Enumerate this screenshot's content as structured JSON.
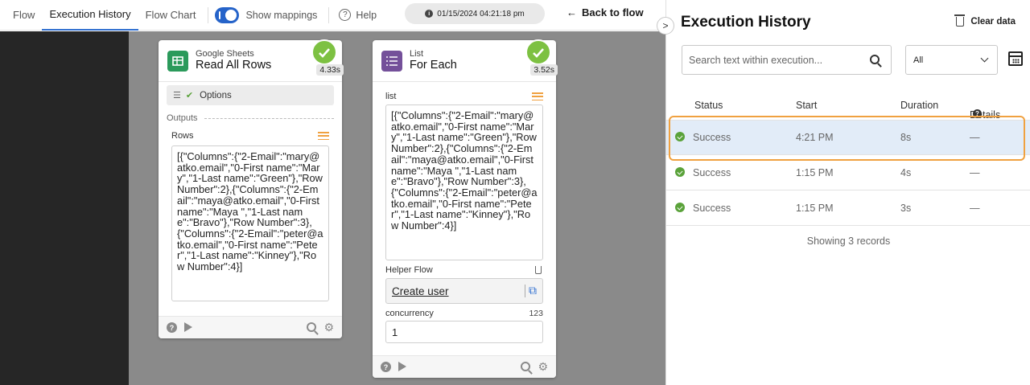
{
  "nav": {
    "tabs": [
      "Flow",
      "Execution History",
      "Flow Chart"
    ],
    "show_mappings": "Show mappings",
    "help": "Help",
    "timestamp": "01/15/2024 04:21:18 pm",
    "back": "Back to flow"
  },
  "cards": {
    "sheets": {
      "app": "Google Sheets",
      "title": "Read All Rows",
      "duration": "4.33s",
      "options": "Options",
      "outputs": "Outputs",
      "field": "Rows",
      "value": "[{\"Columns\":{\"2-Email\":\"mary@atko.email\",\"0-First name\":\"Mary\",\"1-Last name\":\"Green\"},\"Row Number\":2},{\"Columns\":{\"2-Email\":\"maya@atko.email\",\"0-First name\":\"Maya \",\"1-Last name\":\"Bravo\"},\"Row Number\":3},{\"Columns\":{\"2-Email\":\"peter@atko.email\",\"0-First name\":\"Peter\",\"1-Last name\":\"Kinney\"},\"Row Number\":4}]"
    },
    "list": {
      "app": "List",
      "title": "For Each",
      "duration": "3.52s",
      "field": "list",
      "value": "[{\"Columns\":{\"2-Email\":\"mary@atko.email\",\"0-First name\":\"Mary\",\"1-Last name\":\"Green\"},\"Row Number\":2},{\"Columns\":{\"2-Email\":\"maya@atko.email\",\"0-First name\":\"Maya \",\"1-Last name\":\"Bravo\"},\"Row Number\":3},{\"Columns\":{\"2-Email\":\"peter@atko.email\",\"0-First name\":\"Peter\",\"1-Last name\":\"Kinney\"},\"Row Number\":4}]",
      "helper_label": "Helper Flow",
      "helper_value": "Create user",
      "concurrency_label": "concurrency",
      "concurrency_type": "123",
      "concurrency_value": "1"
    }
  },
  "panel": {
    "title": "Execution History",
    "clear": "Clear data",
    "search_placeholder": "Search text within execution...",
    "filter": "All",
    "columns": [
      "Status",
      "Start",
      "Duration",
      "Details"
    ],
    "rows": [
      {
        "status": "Success",
        "start": "4:21 PM",
        "duration": "8s",
        "details": "—"
      },
      {
        "status": "Success",
        "start": "1:15 PM",
        "duration": "4s",
        "details": "—"
      },
      {
        "status": "Success",
        "start": "1:15 PM",
        "duration": "3s",
        "details": "—"
      }
    ],
    "records": "Showing 3 records"
  }
}
